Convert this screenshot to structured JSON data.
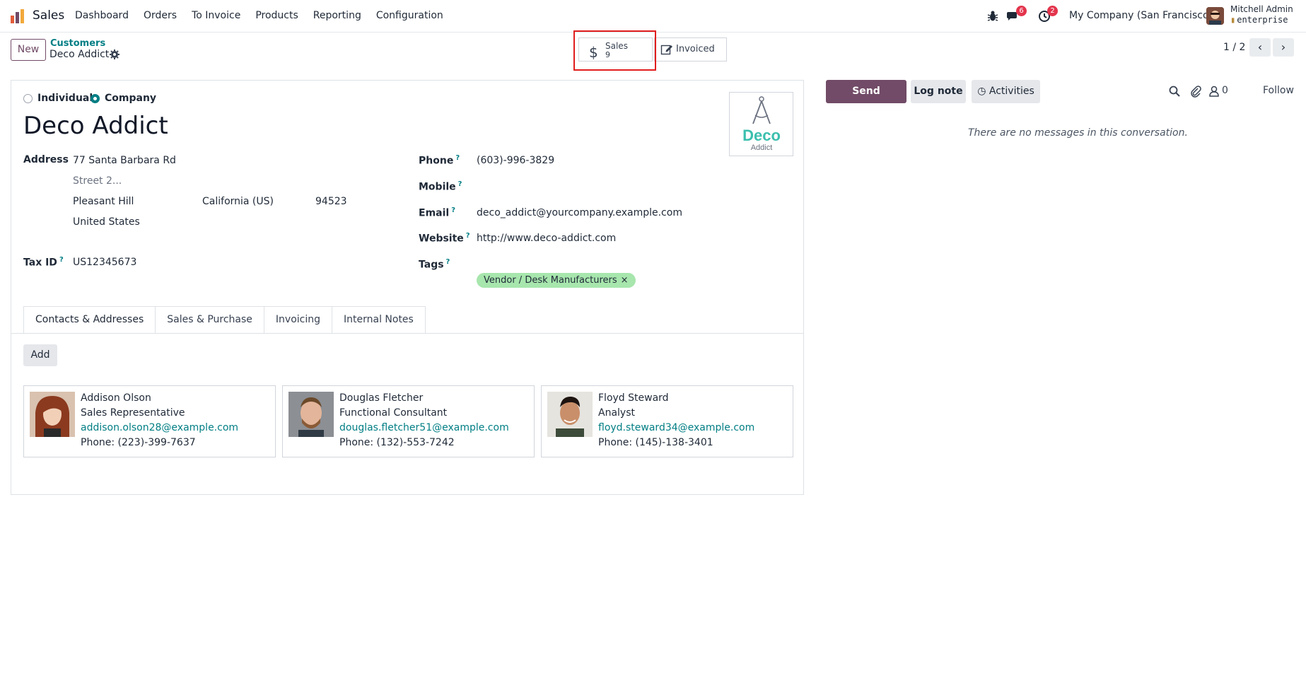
{
  "app": {
    "name": "Sales",
    "menu": [
      "Dashboard",
      "Orders",
      "To Invoice",
      "Products",
      "Reporting",
      "Configuration"
    ]
  },
  "systray": {
    "messages_count": "6",
    "activities_count": "2",
    "company": "My Company (San Francisco)",
    "user_name": "Mitchell Admin",
    "database": "enterprise"
  },
  "control": {
    "new_label": "New",
    "breadcrumb_parent": "Customers",
    "breadcrumb_current": "Deco Addict",
    "smart_sales_label": "Sales",
    "smart_sales_value": "9",
    "smart_invoiced_label": "Invoiced",
    "pager": "1 / 2"
  },
  "form": {
    "company_type_options": [
      "Individual",
      "Company"
    ],
    "company_type_selected": "Company",
    "name": "Deco Addict",
    "logo_text": "Deco",
    "logo_subtext": "Addict",
    "address_label": "Address",
    "street": "77 Santa Barbara Rd",
    "street2_placeholder": "Street 2...",
    "city": "Pleasant Hill",
    "state": "California (US)",
    "zip": "94523",
    "country": "United States",
    "tax_id_label": "Tax ID",
    "tax_id": "US12345673",
    "phone_label": "Phone",
    "phone": "(603)-996-3829",
    "mobile_label": "Mobile",
    "email_label": "Email",
    "email": "deco_addict@yourcompany.example.com",
    "website_label": "Website",
    "website": "http://www.deco-addict.com",
    "tags_label": "Tags",
    "tags": [
      "Vendor / Desk Manufacturers"
    ],
    "help_mark": "?"
  },
  "tabs": [
    "Contacts & Addresses",
    "Sales & Purchase",
    "Invoicing",
    "Internal Notes"
  ],
  "contacts": {
    "add_label": "Add",
    "items": [
      {
        "name": "Addison Olson",
        "function": "Sales Representative",
        "email": "addison.olson28@example.com",
        "phone": "Phone: (223)-399-7637"
      },
      {
        "name": "Douglas Fletcher",
        "function": "Functional Consultant",
        "email": "douglas.fletcher51@example.com",
        "phone": "Phone: (132)-553-7242"
      },
      {
        "name": "Floyd Steward",
        "function": "Analyst",
        "email": "floyd.steward34@example.com",
        "phone": "Phone: (145)-138-3401"
      }
    ]
  },
  "chatter": {
    "send_message": "Send message",
    "log_note": "Log note",
    "activities": "Activities",
    "followers_count": "0",
    "follow": "Follow",
    "empty": "There are no messages in this conversation."
  },
  "colors": {
    "brand": "#714b67",
    "accent": "#017e84",
    "tag": "#a7e6ad",
    "highlight": "#e11d1d",
    "badge": "#e3344c"
  }
}
